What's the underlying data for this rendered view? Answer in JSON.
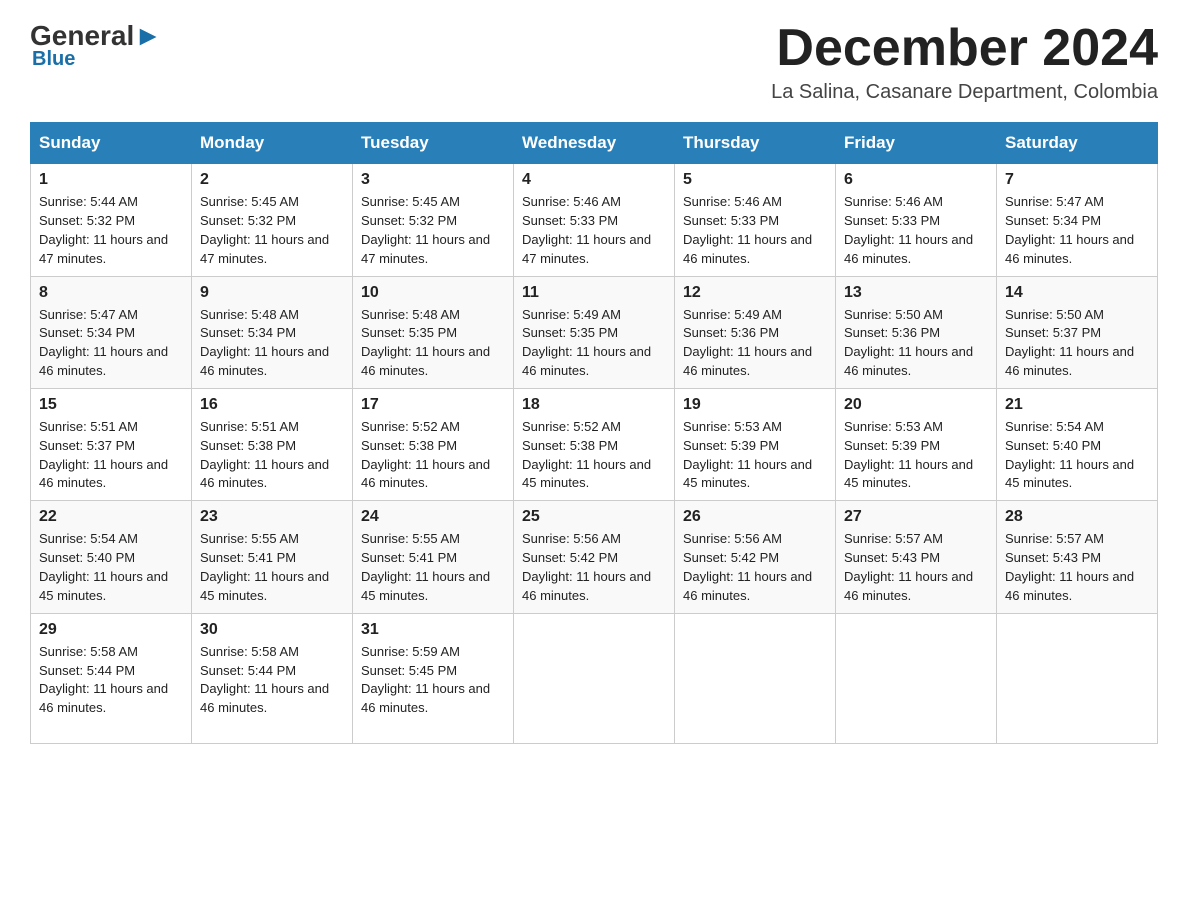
{
  "header": {
    "logo": {
      "general": "General",
      "blue": "Blue",
      "triangle": "▶"
    },
    "title": "December 2024",
    "location": "La Salina, Casanare Department, Colombia"
  },
  "days_of_week": [
    "Sunday",
    "Monday",
    "Tuesday",
    "Wednesday",
    "Thursday",
    "Friday",
    "Saturday"
  ],
  "weeks": [
    [
      {
        "day": "1",
        "sunrise": "5:44 AM",
        "sunset": "5:32 PM",
        "daylight": "11 hours and 47 minutes."
      },
      {
        "day": "2",
        "sunrise": "5:45 AM",
        "sunset": "5:32 PM",
        "daylight": "11 hours and 47 minutes."
      },
      {
        "day": "3",
        "sunrise": "5:45 AM",
        "sunset": "5:32 PM",
        "daylight": "11 hours and 47 minutes."
      },
      {
        "day": "4",
        "sunrise": "5:46 AM",
        "sunset": "5:33 PM",
        "daylight": "11 hours and 47 minutes."
      },
      {
        "day": "5",
        "sunrise": "5:46 AM",
        "sunset": "5:33 PM",
        "daylight": "11 hours and 46 minutes."
      },
      {
        "day": "6",
        "sunrise": "5:46 AM",
        "sunset": "5:33 PM",
        "daylight": "11 hours and 46 minutes."
      },
      {
        "day": "7",
        "sunrise": "5:47 AM",
        "sunset": "5:34 PM",
        "daylight": "11 hours and 46 minutes."
      }
    ],
    [
      {
        "day": "8",
        "sunrise": "5:47 AM",
        "sunset": "5:34 PM",
        "daylight": "11 hours and 46 minutes."
      },
      {
        "day": "9",
        "sunrise": "5:48 AM",
        "sunset": "5:34 PM",
        "daylight": "11 hours and 46 minutes."
      },
      {
        "day": "10",
        "sunrise": "5:48 AM",
        "sunset": "5:35 PM",
        "daylight": "11 hours and 46 minutes."
      },
      {
        "day": "11",
        "sunrise": "5:49 AM",
        "sunset": "5:35 PM",
        "daylight": "11 hours and 46 minutes."
      },
      {
        "day": "12",
        "sunrise": "5:49 AM",
        "sunset": "5:36 PM",
        "daylight": "11 hours and 46 minutes."
      },
      {
        "day": "13",
        "sunrise": "5:50 AM",
        "sunset": "5:36 PM",
        "daylight": "11 hours and 46 minutes."
      },
      {
        "day": "14",
        "sunrise": "5:50 AM",
        "sunset": "5:37 PM",
        "daylight": "11 hours and 46 minutes."
      }
    ],
    [
      {
        "day": "15",
        "sunrise": "5:51 AM",
        "sunset": "5:37 PM",
        "daylight": "11 hours and 46 minutes."
      },
      {
        "day": "16",
        "sunrise": "5:51 AM",
        "sunset": "5:38 PM",
        "daylight": "11 hours and 46 minutes."
      },
      {
        "day": "17",
        "sunrise": "5:52 AM",
        "sunset": "5:38 PM",
        "daylight": "11 hours and 46 minutes."
      },
      {
        "day": "18",
        "sunrise": "5:52 AM",
        "sunset": "5:38 PM",
        "daylight": "11 hours and 45 minutes."
      },
      {
        "day": "19",
        "sunrise": "5:53 AM",
        "sunset": "5:39 PM",
        "daylight": "11 hours and 45 minutes."
      },
      {
        "day": "20",
        "sunrise": "5:53 AM",
        "sunset": "5:39 PM",
        "daylight": "11 hours and 45 minutes."
      },
      {
        "day": "21",
        "sunrise": "5:54 AM",
        "sunset": "5:40 PM",
        "daylight": "11 hours and 45 minutes."
      }
    ],
    [
      {
        "day": "22",
        "sunrise": "5:54 AM",
        "sunset": "5:40 PM",
        "daylight": "11 hours and 45 minutes."
      },
      {
        "day": "23",
        "sunrise": "5:55 AM",
        "sunset": "5:41 PM",
        "daylight": "11 hours and 45 minutes."
      },
      {
        "day": "24",
        "sunrise": "5:55 AM",
        "sunset": "5:41 PM",
        "daylight": "11 hours and 45 minutes."
      },
      {
        "day": "25",
        "sunrise": "5:56 AM",
        "sunset": "5:42 PM",
        "daylight": "11 hours and 46 minutes."
      },
      {
        "day": "26",
        "sunrise": "5:56 AM",
        "sunset": "5:42 PM",
        "daylight": "11 hours and 46 minutes."
      },
      {
        "day": "27",
        "sunrise": "5:57 AM",
        "sunset": "5:43 PM",
        "daylight": "11 hours and 46 minutes."
      },
      {
        "day": "28",
        "sunrise": "5:57 AM",
        "sunset": "5:43 PM",
        "daylight": "11 hours and 46 minutes."
      }
    ],
    [
      {
        "day": "29",
        "sunrise": "5:58 AM",
        "sunset": "5:44 PM",
        "daylight": "11 hours and 46 minutes."
      },
      {
        "day": "30",
        "sunrise": "5:58 AM",
        "sunset": "5:44 PM",
        "daylight": "11 hours and 46 minutes."
      },
      {
        "day": "31",
        "sunrise": "5:59 AM",
        "sunset": "5:45 PM",
        "daylight": "11 hours and 46 minutes."
      },
      null,
      null,
      null,
      null
    ]
  ]
}
